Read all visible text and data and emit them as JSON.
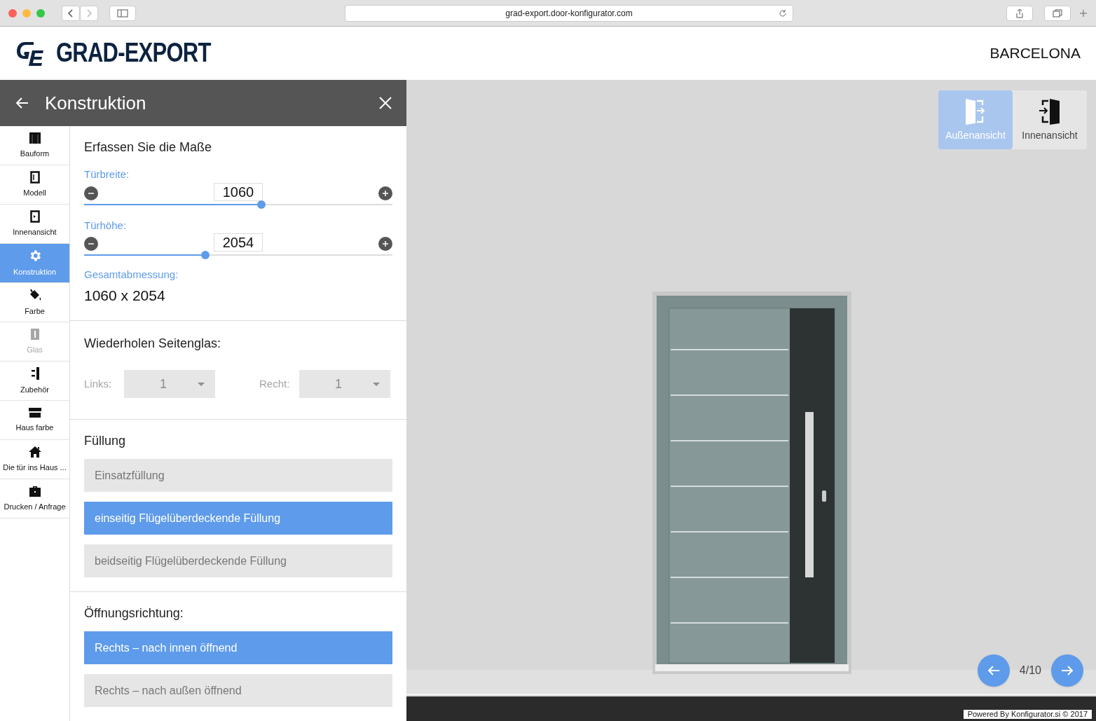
{
  "browser": {
    "url": "grad-export.door-konfigurator.com"
  },
  "header": {
    "brand": "GRAD-EXPORT",
    "model": "BARCELONA"
  },
  "panel": {
    "title": "Konstruktion"
  },
  "sidebar": {
    "items": [
      {
        "label": "Bauform",
        "selected": false,
        "disabled": false
      },
      {
        "label": "Modell",
        "selected": false,
        "disabled": false
      },
      {
        "label": "Innenansicht",
        "selected": false,
        "disabled": false
      },
      {
        "label": "Konstruktion",
        "selected": true,
        "disabled": false
      },
      {
        "label": "Farbe",
        "selected": false,
        "disabled": false
      },
      {
        "label": "Glas",
        "selected": false,
        "disabled": true
      },
      {
        "label": "Zubehör",
        "selected": false,
        "disabled": false
      },
      {
        "label": "Haus farbe",
        "selected": false,
        "disabled": false
      },
      {
        "label": "Die tür ins Haus ...",
        "selected": false,
        "disabled": false
      },
      {
        "label": "Drucken / Anfrage",
        "selected": false,
        "disabled": false
      }
    ]
  },
  "dimensions": {
    "heading": "Erfassen Sie die Maße",
    "sliders": [
      {
        "label": "Türbreite:",
        "value": "1060",
        "level": 0.575
      },
      {
        "label": "Türhöhe:",
        "value": "2054",
        "level": 0.394
      }
    ],
    "total_label": "Gesamtabmessung:",
    "total": "1060 x 2054"
  },
  "side_glass": {
    "heading": "Wiederholen Seitenglas:",
    "selects": [
      {
        "label": "Links:",
        "value": "1",
        "disabled": true
      },
      {
        "label": "Recht:",
        "value": "1",
        "disabled": true
      }
    ]
  },
  "filling": {
    "heading": "Füllung",
    "options": [
      {
        "label": "Einsatzfüllung",
        "selected": false
      },
      {
        "label": "einseitig Flügelüberdeckende Füllung",
        "selected": true
      },
      {
        "label": "beidseitig Flügelüberdeckende Füllung",
        "selected": false
      }
    ]
  },
  "opening": {
    "heading": "Öffnungsrichtung:",
    "options": [
      {
        "label": "Rechts – nach innen öffnend",
        "selected": true
      },
      {
        "label": "Rechts – nach außen öffnend",
        "selected": false
      }
    ]
  },
  "view_tabs": [
    {
      "label": "Außenansicht",
      "selected": true
    },
    {
      "label": "Innenansicht",
      "selected": false
    }
  ],
  "pager": {
    "text": "4/10"
  },
  "footer": {
    "credit": "Powered By Konfigurator.si © 2017"
  }
}
